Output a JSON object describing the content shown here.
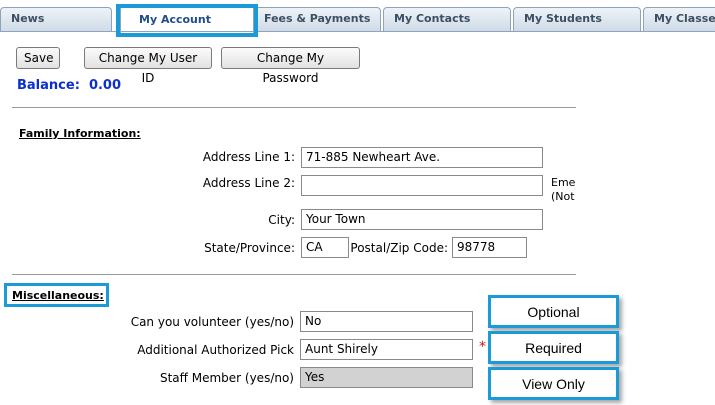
{
  "tabs": [
    {
      "label": "News"
    },
    {
      "label": "My Account"
    },
    {
      "label": "Fees & Payments"
    },
    {
      "label": "My Contacts"
    },
    {
      "label": "My Students"
    },
    {
      "label": "My Classes"
    }
  ],
  "toolbar": {
    "save_label": "Save",
    "change_user_id_label": "Change My User ID",
    "change_password_label": "Change My Password"
  },
  "balance": {
    "label": "Balance:",
    "value": "0.00"
  },
  "family": {
    "heading": "Family Information:",
    "address1": {
      "label": "Address Line 1:",
      "value": "71-885 Newheart Ave."
    },
    "address2": {
      "label": "Address Line 2:",
      "value": ""
    },
    "city": {
      "label": "City:",
      "value": "Your Town"
    },
    "state": {
      "label": "State/Province:",
      "value": "CA"
    },
    "postal": {
      "label": "Postal/Zip Code:",
      "value": "98778"
    },
    "emergency_clip": {
      "line1": "Emer",
      "line2": "(Not"
    }
  },
  "misc": {
    "heading": "Miscellaneous:",
    "volunteer": {
      "label": "Can you volunteer (yes/no)",
      "value": "No"
    },
    "pickup": {
      "label": "Additional Authorized Pick",
      "value": "Aunt Shirely"
    },
    "staff": {
      "label": "Staff Member (yes/no)",
      "value": "Yes"
    },
    "required_marker": "*"
  },
  "callouts": {
    "optional": "Optional",
    "required": "Required",
    "view_only": "View Only"
  },
  "colors": {
    "highlight": "#1a9ad6",
    "balance": "#0a2fd1",
    "required_star": "#dd1111"
  }
}
